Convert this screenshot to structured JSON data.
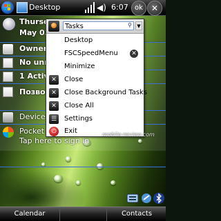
{
  "topbar": {
    "title": "Desktop",
    "clock": "6:07",
    "ok_label": "ok"
  },
  "today": {
    "date_line1": "Thursday,",
    "date_line2": "May 03",
    "owner": "Owner:",
    "unread": "No unread",
    "tasks_active": "1 Active",
    "calendar": "Позвон",
    "wireless": "Device",
    "pocket_msn": "Pocket M",
    "tap_hint": "Tap here to sign in"
  },
  "menu": {
    "search_value": "Tasks",
    "items": [
      {
        "label": "Desktop"
      },
      {
        "label": "FSCSpeedMenu"
      },
      {
        "label": "Minimize"
      },
      {
        "label": "Close"
      },
      {
        "label": "Close Background Tasks"
      },
      {
        "label": "Close All"
      },
      {
        "label": "Settings"
      },
      {
        "label": "Exit"
      }
    ]
  },
  "watermark": "mobile-review.com",
  "softkeys": {
    "left": "Calendar",
    "right": "Contacts"
  }
}
